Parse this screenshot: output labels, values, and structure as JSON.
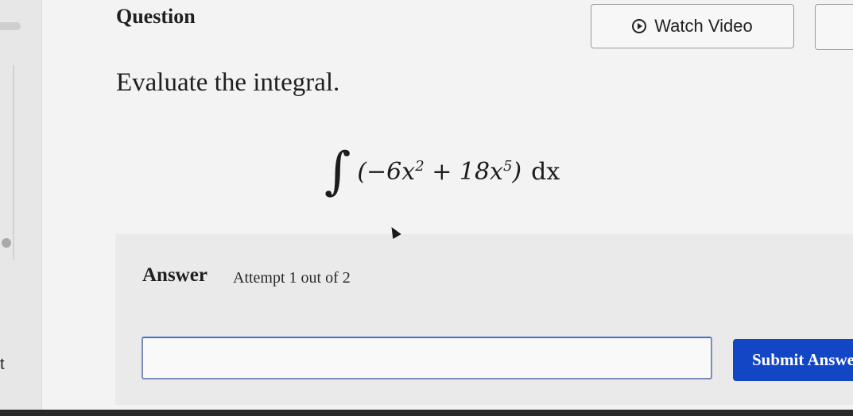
{
  "sidebar": {
    "partial_label": "t"
  },
  "header": {
    "title": "Question",
    "watch_video_label": "Watch Video"
  },
  "question": {
    "prompt": "Evaluate the integral.",
    "integral_sign": "∫",
    "expression": {
      "open": "(−6x",
      "exp1": "2",
      "mid": " + 18x",
      "exp2": "5",
      "close": ")"
    },
    "differential": "dx"
  },
  "answer": {
    "label": "Answer",
    "attempt_text": "Attempt 1 out of 2",
    "input_value": "",
    "submit_label": "Submit Answer"
  },
  "colors": {
    "submit_bg": "#1346c5",
    "input_border": "#3b6fd0"
  }
}
